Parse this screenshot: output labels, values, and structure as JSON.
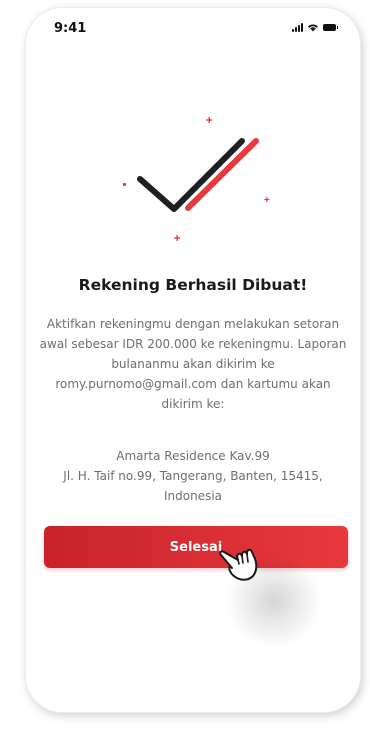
{
  "status_bar": {
    "time": "9:41"
  },
  "success": {
    "title": "Rekening Berhasil Dibuat!",
    "description": "Aktifkan rekeningmu dengan melakukan setoran awal sebesar IDR 200.000 ke rekeningmu. Laporan bulananmu akan dikirim ke romy.purnomo@gmail.com dan kartumu akan dikirim ke:",
    "address_line1": "Amarta Residence Kav.99",
    "address_line2": "Jl. H. Taif no.99, Tangerang, Banten, 15415,",
    "address_line3": "Indonesia"
  },
  "actions": {
    "done_label": "Selesai"
  },
  "colors": {
    "accent": "#e8383d",
    "accent_dark": "#c8232b",
    "check_dark": "#1f1f1f",
    "text_primary": "#1a1a1a",
    "text_secondary": "#6f6f6f"
  },
  "icons": {
    "check": "double-check-icon",
    "cursor": "hand-pointer-icon"
  }
}
